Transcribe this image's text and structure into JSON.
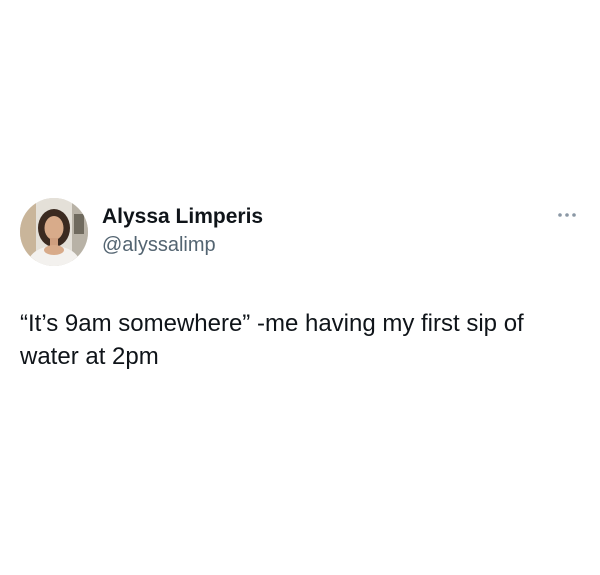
{
  "tweet": {
    "author": {
      "display_name": "Alyssa Limperis",
      "handle": "@alyssalimp"
    },
    "text": "“It’s 9am somewhere” -me having my first sip of water at 2pm",
    "icons": {
      "avatar": "profile-photo",
      "more": "more-options-icon"
    }
  }
}
